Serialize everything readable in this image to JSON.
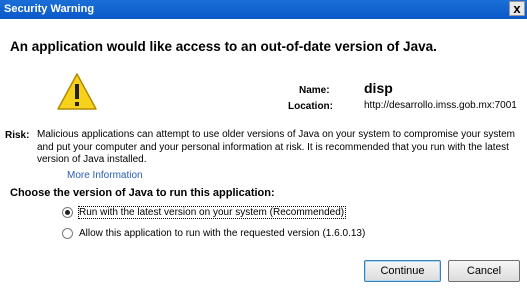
{
  "window": {
    "title": "Security Warning",
    "close_glyph": "x"
  },
  "heading": "An application would like access to an out-of-date version of Java.",
  "icon": "warning-triangle-icon",
  "app": {
    "name_label": "Name:",
    "name_value": "disp",
    "location_label": "Location:",
    "location_value": "http://desarrollo.imss.gob.mx:7001"
  },
  "risk": {
    "label": "Risk:",
    "text": "Malicious applications can attempt to use older versions of Java on your system to compromise your system and put your computer and your personal information at risk. It is recommended that you run with the latest version of Java installed.",
    "more_info_link": "More Information"
  },
  "choice": {
    "heading": "Choose the version of Java to run this application:",
    "options": [
      {
        "label": "Run with the latest version on your system (Recommended)",
        "selected": true
      },
      {
        "label": "Allow this application to run with the requested version (1.6.0.13)",
        "selected": false
      }
    ]
  },
  "buttons": {
    "continue": "Continue",
    "cancel": "Cancel"
  },
  "colors": {
    "titlebar": "#0a58c8",
    "link": "#2a5db0",
    "warning_fill": "#f7d21a"
  }
}
